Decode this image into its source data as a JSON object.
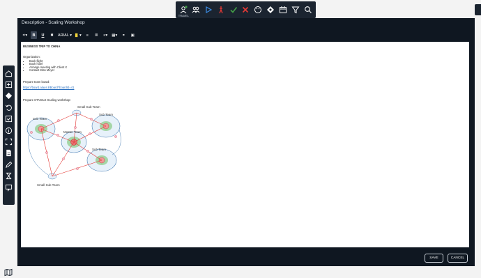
{
  "top_toolbar": {
    "icons": [
      "person-warning-icon",
      "people-icon",
      "play-icon",
      "run-icon",
      "check-icon",
      "close-icon",
      "palette-icon",
      "diamond-icon",
      "calendar-icon",
      "filter-icon",
      "search-icon"
    ],
    "first_caption": "TRAVEL"
  },
  "left_bar": {
    "icons": [
      "home-icon",
      "plus-icon",
      "diamond-icon",
      "undo-icon",
      "checkbox-icon",
      "info-icon",
      "fullscreen-icon",
      "document-icon",
      "pencil-icon",
      "hourglass-icon",
      "comment-icon"
    ]
  },
  "dialog": {
    "title": "Description - Scaling Workshop",
    "toolbar": {
      "magic": "✶▾",
      "bold": "B",
      "underline": "U",
      "clear": "✖",
      "font": "ARIAL ▾",
      "highlight": "▾",
      "bullet": "≡",
      "number": "≣",
      "align": "≡▾",
      "table": "▦▾",
      "link": "⚭",
      "image": "▣"
    },
    "content": {
      "heading": "BUSINESS TRIP TO CHINA",
      "organization_label": "Organization:",
      "organization_items": [
        "Book flight",
        "Book hotel",
        "Arrange meeting with Client X",
        "Contact Miss Meyer"
      ],
      "prepare_team_board": "Prepare team board:",
      "team_board_link": "https://board.alaus.li/Board?boardId=41",
      "prepare_workshop": "Prepare STAGILE Scaling workshop:",
      "diagram_labels": {
        "small_sub_team_top": "Small Sub Team",
        "sub_team_left": "Sub Team",
        "sub_team_right": "Sub Team",
        "master_team": "Master Team",
        "sub_team_bottom": "Sub Team",
        "small_sub_team_bottom": "Small Sub Team"
      }
    },
    "buttons": {
      "save": "SAVE",
      "cancel": "CANCEL"
    }
  },
  "colors": {
    "toolbar_bg": "#1b2430",
    "accent_blue": "#3b8ee8",
    "accent_red": "#e53935",
    "accent_green": "#43a047",
    "accent_orange": "#fb8c00",
    "dialog_bg": "#0f1721"
  }
}
